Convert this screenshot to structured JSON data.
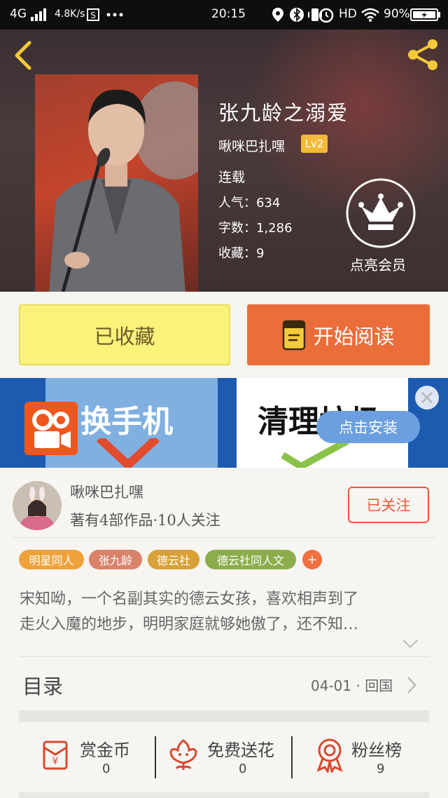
{
  "status_bar": {
    "network": "4G",
    "speed": "4.8K/s",
    "time": "20:15",
    "hd": "HD",
    "battery": "90%"
  },
  "book": {
    "title": "张九龄之溺爱",
    "author": "啾咪巴扎嘿",
    "level": "Lv2",
    "status": "连载",
    "popularity_label": "人气：",
    "popularity": "634",
    "word_count_label": "字数：",
    "word_count": "1,286",
    "favorites_label": "收藏：",
    "favorites": "9"
  },
  "vip": {
    "label": "点亮会员"
  },
  "actions": {
    "favorited_label": "已收藏",
    "start_reading_label": "开始阅读"
  },
  "ad": {
    "left_text": "换手机",
    "right_text": "清理垃圾",
    "install_label": "点击安装"
  },
  "author_card": {
    "name": "啾咪巴扎嘿",
    "summary": "著有4部作品·10人关注",
    "follow_label": "已关注"
  },
  "tags": [
    "明星同人",
    "张九龄",
    "德云社",
    "德云社同人文",
    "+"
  ],
  "colors": {
    "tag_1": "#f0a23a",
    "tag_2": "#d9826a",
    "tag_3": "#d9a038",
    "tag_4": "#8cad4c",
    "tag_plus": "#f07040",
    "accent_orange": "#ea6d3a",
    "favorite_yellow": "#fbf27a"
  },
  "description": {
    "line1": "宋知呦，一个名副其实的德云女孩，喜欢相声到了",
    "line2": "走火入魔的地步，明明家庭就够她傲了，还不知…"
  },
  "catalog": {
    "title": "目录",
    "latest": "04-01 · 回国"
  },
  "stats": [
    {
      "label": "赏金币",
      "value": "0",
      "icon": "red-envelope-icon"
    },
    {
      "label": "免费送花",
      "value": "0",
      "icon": "flower-icon"
    },
    {
      "label": "粉丝榜",
      "value": "9",
      "icon": "ribbon-medal-icon"
    }
  ]
}
